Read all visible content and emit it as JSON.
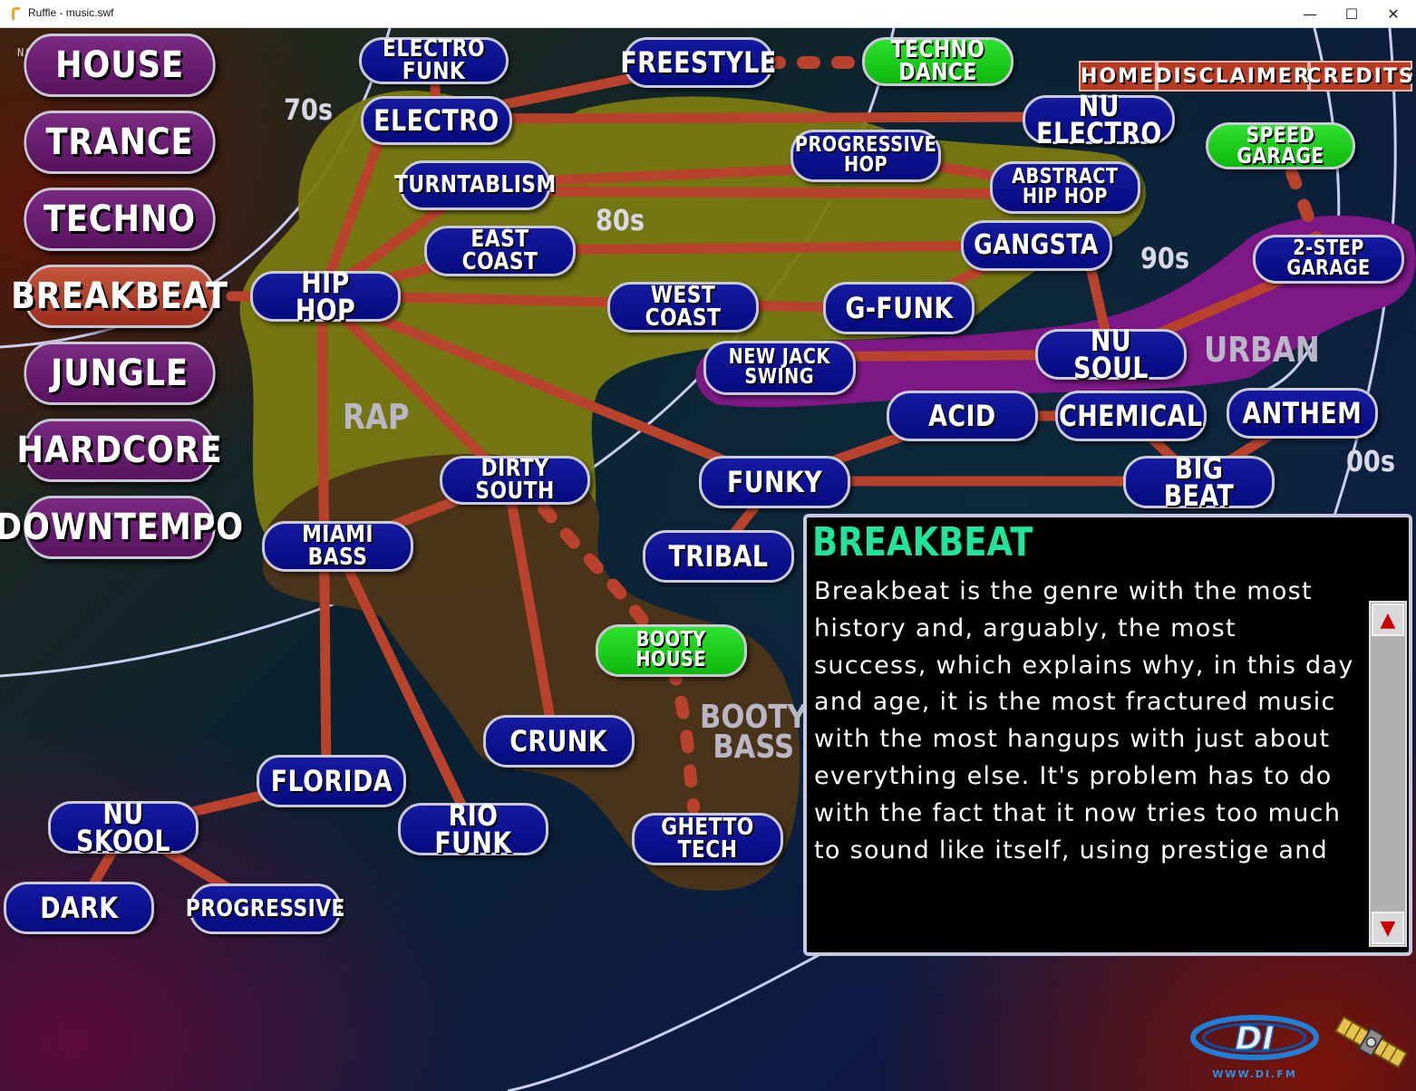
{
  "window": {
    "title": "Ruffle - music.swf",
    "controls": {
      "minimize": "—",
      "maximize": "☐",
      "close": "✕"
    }
  },
  "corner_text": "NO DC",
  "genres": [
    {
      "label": "HOUSE",
      "active": false
    },
    {
      "label": "TRANCE",
      "active": false
    },
    {
      "label": "TECHNO",
      "active": false
    },
    {
      "label": "BREAKBEAT",
      "active": true
    },
    {
      "label": "JUNGLE",
      "active": false
    },
    {
      "label": "HARDCORE",
      "active": false
    },
    {
      "label": "DOWNTEMPO",
      "active": false
    }
  ],
  "nav": {
    "home": "HOME",
    "disclaimer": "DISCLAIMER",
    "credits": "CREDITS"
  },
  "eras": {
    "e70": "70s",
    "e80": "80s",
    "e90": "90s",
    "e00": "00s"
  },
  "regions": {
    "rap": "RAP",
    "urban": "URBAN",
    "booty_bass": "BOOTY\nBASS"
  },
  "nodes": {
    "electro_funk": "ELECTRO FUNK",
    "freestyle": "FREESTYLE",
    "techno_dance": "TECHNO DANCE",
    "electro": "ELECTRO",
    "nu_electro": "NU ELECTRO",
    "progressive_hop": "PROGRESSIVE\nHOP",
    "speed_garage": "SPEED GARAGE",
    "turntablism": "TURNTABLISM",
    "abstract_hip_hop": "ABSTRACT\nHIP HOP",
    "east_coast": "EAST COAST",
    "gangsta": "GANGSTA",
    "two_step_garage": "2-STEP GARAGE",
    "hip_hop": "HIP HOP",
    "west_coast": "WEST COAST",
    "g_funk": "G-FUNK",
    "new_jack_swing": "NEW JACK\nSWING",
    "nu_soul": "NU SOUL",
    "acid": "ACID",
    "chemical": "CHEMICAL",
    "anthem": "ANTHEM",
    "dirty_south": "DIRTY SOUTH",
    "funky": "FUNKY",
    "big_beat": "BIG BEAT",
    "miami_bass": "MIAMI BASS",
    "tribal": "TRIBAL",
    "booty_house": "BOOTY\nHOUSE",
    "crunk": "CRUNK",
    "florida": "FLORIDA",
    "nu_skool": "NU SKOOL",
    "rio_funk": "RIO FUNK",
    "ghetto_tech": "GHETTO TECH",
    "dark": "DARK",
    "progressive": "PROGRESSIVE"
  },
  "info": {
    "title": "BREAKBEAT",
    "body": "Breakbeat is the genre with the most history and, arguably, the most success, which explains why, in this day and age, it is the most fractured music with the most hangups with just about everything else. It's problem has to do with the fact that it now tries too much to sound like itself, using prestige and",
    "scroll_up": "▲",
    "scroll_down": "▼"
  },
  "logo": {
    "difm_text": "DI",
    "difm_url": "WWW.DI.FM"
  },
  "colors": {
    "node_blue": "#0a0f8c",
    "node_green": "#18cc18",
    "menu_purple": "#6a1c70",
    "menu_active": "#b9442c",
    "connector": "#b9422c",
    "rap_region": "#7a7a10",
    "urban_region": "#7e1886",
    "booty_region": "#4a3418",
    "info_title": "#1fe49a"
  }
}
